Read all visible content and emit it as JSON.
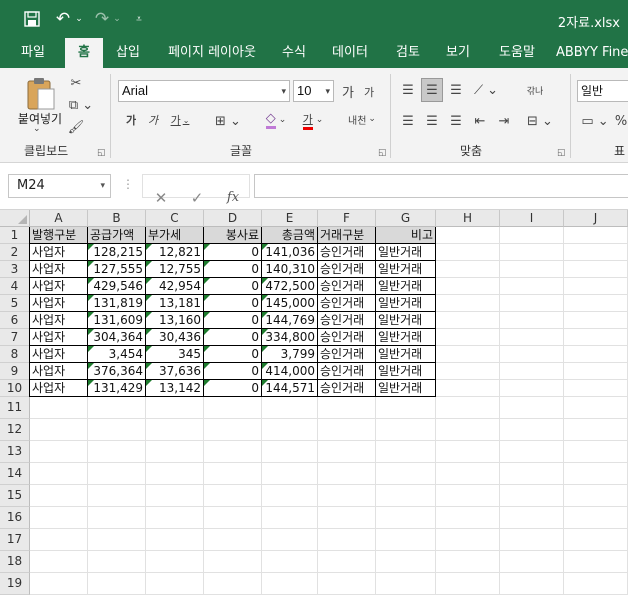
{
  "title_bar": {
    "file_name": "2자료.xlsx"
  },
  "ribbon_tabs": [
    "파일",
    "홈",
    "삽입",
    "페이지 레이아웃",
    "수식",
    "데이터",
    "검토",
    "보기",
    "도움말",
    "ABBYY FineR"
  ],
  "clipboard": {
    "paste_label": "붙여넣기",
    "group_label": "클립보드"
  },
  "font": {
    "name": "Arial",
    "size": "10",
    "group_label": "글꼴",
    "bold": "가",
    "italic": "가",
    "underline": "가",
    "color_a": "가",
    "grow": "가",
    "shrink": "가",
    "phonetic": "내천"
  },
  "alignment": {
    "group_label": "맞춤",
    "wrap": "갂나"
  },
  "number": {
    "format": "일반",
    "group_label": "표"
  },
  "formula_bar": {
    "name_box": "M24",
    "cancel": "✕",
    "enter": "✓",
    "fx": "fx",
    "formula": ""
  },
  "columns": [
    "A",
    "B",
    "C",
    "D",
    "E",
    "F",
    "G",
    "H",
    "I",
    "J"
  ],
  "rows": [
    "1",
    "2",
    "3",
    "4",
    "5",
    "6",
    "7",
    "8",
    "9",
    "10",
    "11",
    "12",
    "13",
    "14",
    "15",
    "16",
    "17",
    "18",
    "19"
  ],
  "table": {
    "headers": [
      "발행구분",
      "공급가액",
      "부가세",
      "봉사료",
      "총금액",
      "거래구분",
      "비고"
    ],
    "rows": [
      [
        "사업자",
        "128,215",
        "12,821",
        "0",
        "141,036",
        "승인거래",
        "일반거래"
      ],
      [
        "사업자",
        "127,555",
        "12,755",
        "0",
        "140,310",
        "승인거래",
        "일반거래"
      ],
      [
        "사업자",
        "429,546",
        "42,954",
        "0",
        "472,500",
        "승인거래",
        "일반거래"
      ],
      [
        "사업자",
        "131,819",
        "13,181",
        "0",
        "145,000",
        "승인거래",
        "일반거래"
      ],
      [
        "사업자",
        "131,609",
        "13,160",
        "0",
        "144,769",
        "승인거래",
        "일반거래"
      ],
      [
        "사업자",
        "304,364",
        "30,436",
        "0",
        "334,800",
        "승인거래",
        "일반거래"
      ],
      [
        "사업자",
        "3,454",
        "345",
        "0",
        "3,799",
        "승인거래",
        "일반거래"
      ],
      [
        "사업자",
        "376,364",
        "37,636",
        "0",
        "414,000",
        "승인거래",
        "일반거래"
      ],
      [
        "사업자",
        "131,429",
        "13,142",
        "0",
        "144,571",
        "승인거래",
        "일반거래"
      ]
    ]
  }
}
